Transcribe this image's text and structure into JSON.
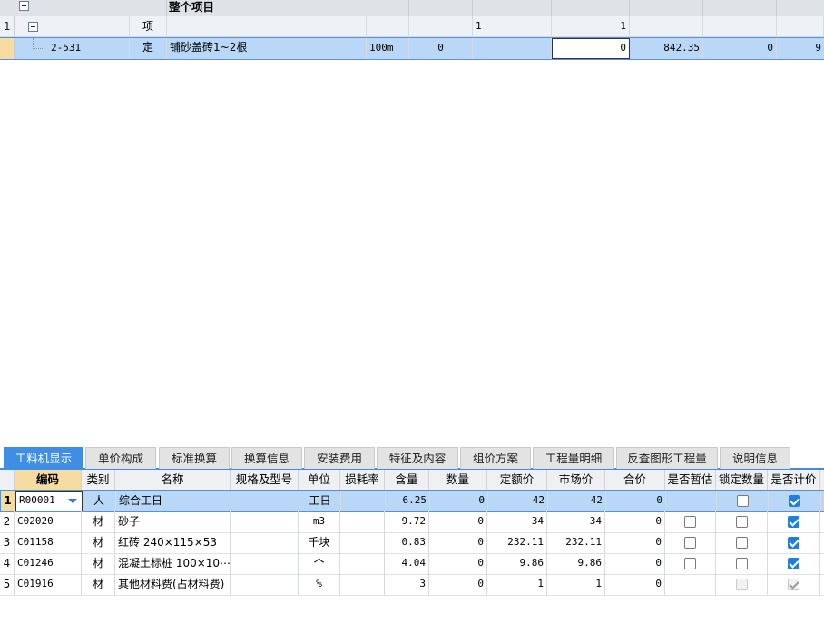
{
  "top": {
    "project_title": "整个项目",
    "rows": [
      {
        "num": "1",
        "code": "",
        "type": "项",
        "name": "",
        "unit": "",
        "qty_expr": "",
        "qty": "1",
        "f2": "1",
        "f3": "",
        "f4": "",
        "f5": ""
      },
      {
        "num": "",
        "code": "2-531",
        "type": "定",
        "name": "铺砂盖砖1~2根",
        "unit": "100m",
        "qty_expr": "0",
        "qty": "",
        "f2": "0",
        "f3": "842.35",
        "f4": "0",
        "f5": "9"
      }
    ]
  },
  "tabs": [
    "工料机显示",
    "单价构成",
    "标准换算",
    "换算信息",
    "安装费用",
    "特征及内容",
    "组价方案",
    "工程量明细",
    "反查图形工程量",
    "说明信息"
  ],
  "active_tab": "工料机显示",
  "columns": [
    "编码",
    "类别",
    "名称",
    "规格及型号",
    "单位",
    "损耗率",
    "含量",
    "数量",
    "定额价",
    "市场价",
    "合价",
    "是否暂估",
    "锁定数量",
    "是否计价"
  ],
  "rows": [
    {
      "num": "1",
      "code": "R00001",
      "cat": "人",
      "name": "综合工日",
      "spec": "",
      "unit": "工日",
      "loss": "",
      "content": "6.25",
      "qty": "0",
      "quota": "42",
      "market": "42",
      "total": "0",
      "provisional": null,
      "locked": false,
      "priced": true,
      "disabled": false
    },
    {
      "num": "2",
      "code": "C02020",
      "cat": "材",
      "name": "砂子",
      "spec": "",
      "unit": "m3",
      "loss": "",
      "content": "9.72",
      "qty": "0",
      "quota": "34",
      "market": "34",
      "total": "0",
      "provisional": false,
      "locked": false,
      "priced": true,
      "disabled": false
    },
    {
      "num": "3",
      "code": "C01158",
      "cat": "材",
      "name": "红砖 240×115×53",
      "spec": "",
      "unit": "千块",
      "loss": "",
      "content": "0.83",
      "qty": "0",
      "quota": "232.11",
      "market": "232.11",
      "total": "0",
      "provisional": false,
      "locked": false,
      "priced": true,
      "disabled": false
    },
    {
      "num": "4",
      "code": "C01246",
      "cat": "材",
      "name": "混凝土标桩 100×10⋯",
      "spec": "",
      "unit": "个",
      "loss": "",
      "content": "4.04",
      "qty": "0",
      "quota": "9.86",
      "market": "9.86",
      "total": "0",
      "provisional": false,
      "locked": false,
      "priced": true,
      "disabled": false
    },
    {
      "num": "5",
      "code": "C01916",
      "cat": "材",
      "name": "其他材料费(占材料费)",
      "spec": "",
      "unit": "%",
      "loss": "",
      "content": "3",
      "qty": "0",
      "quota": "1",
      "market": "1",
      "total": "0",
      "provisional": null,
      "locked": false,
      "priced": true,
      "disabled": true
    }
  ],
  "colors": {
    "accent": "#3e8ee6",
    "selected_row": "#b9d7f7",
    "header_bg": "#eef0f3"
  }
}
